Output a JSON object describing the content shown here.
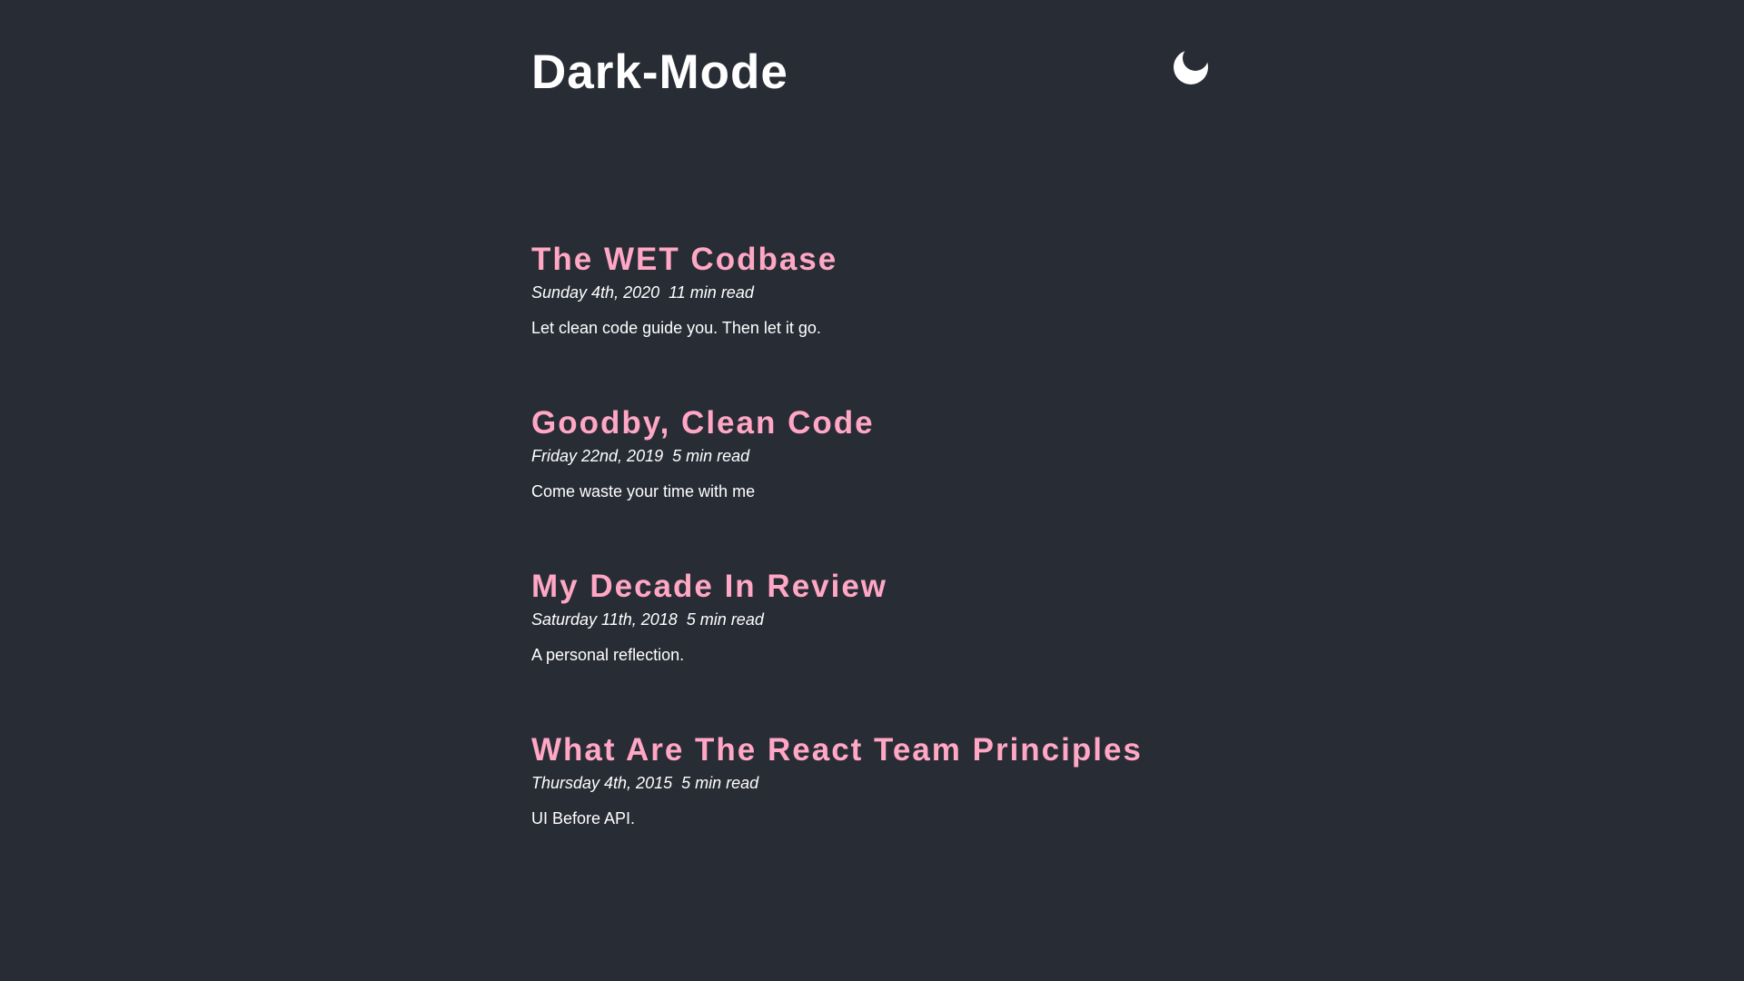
{
  "site": {
    "title": "Dark-Mode",
    "theme_toggle_icon": "moon-icon"
  },
  "colors": {
    "background": "#282c35",
    "accent": "#ffa7c4",
    "text": "#ffffff"
  },
  "posts": [
    {
      "title": "The WET Codbase",
      "date": "Sunday 4th, 2020",
      "read_time": "11 min read",
      "excerpt": "Let clean code guide you. Then let it go."
    },
    {
      "title": "Goodby, Clean Code",
      "date": "Friday 22nd, 2019",
      "read_time": "5 min read",
      "excerpt": "Come waste your time with me"
    },
    {
      "title": "My Decade In Review",
      "date": "Saturday 11th, 2018",
      "read_time": "5 min read",
      "excerpt": "A personal reflection."
    },
    {
      "title": "What Are The React Team Principles",
      "date": "Thursday 4th, 2015",
      "read_time": "5 min read",
      "excerpt": "UI Before API."
    }
  ]
}
